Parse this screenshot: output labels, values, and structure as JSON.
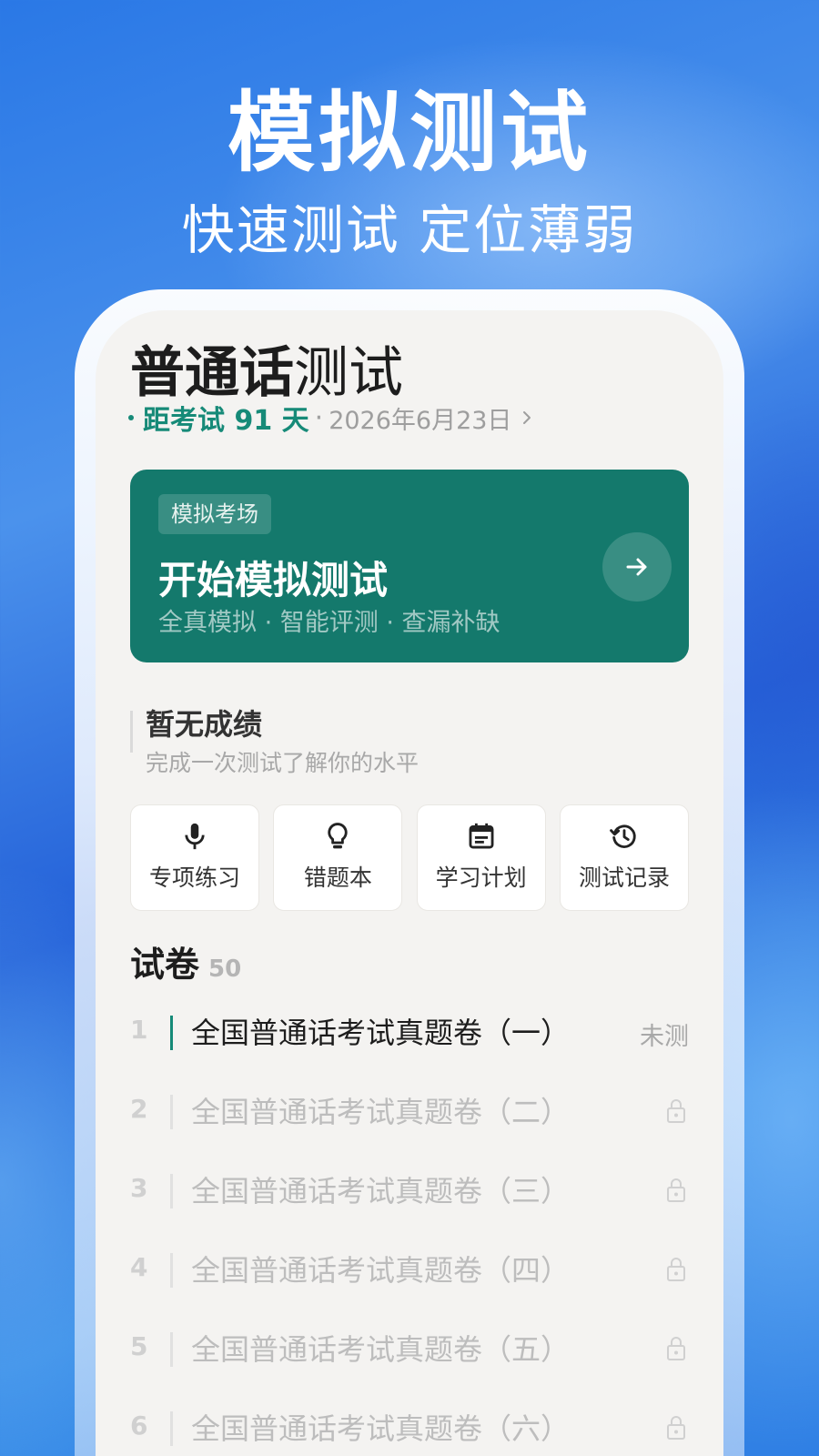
{
  "hero": {
    "title": "模拟测试",
    "subtitle": "快速测试 定位薄弱"
  },
  "app": {
    "title_bold": "普通话",
    "title_rest": "测试",
    "countdown": {
      "label": "距考试 91 天",
      "separator": "·",
      "date": "2026年6月23日"
    }
  },
  "exam_card": {
    "badge": "模拟考场",
    "title": "开始模拟测试",
    "description": "全真模拟 · 智能评测 · 查漏补缺"
  },
  "score": {
    "title": "暂无成绩",
    "subtitle": "完成一次测试了解你的水平"
  },
  "quick_actions": [
    {
      "label": "专项练习",
      "icon": "mic-icon"
    },
    {
      "label": "错题本",
      "icon": "lightbulb-icon"
    },
    {
      "label": "学习计划",
      "icon": "calendar-icon"
    },
    {
      "label": "测试记录",
      "icon": "history-icon"
    }
  ],
  "papers": {
    "title": "试卷",
    "count": "50",
    "items": [
      {
        "num": "1",
        "name": "全国普通话考试真题卷（一）",
        "status": "未测",
        "locked": false
      },
      {
        "num": "2",
        "name": "全国普通话考试真题卷（二）",
        "locked": true
      },
      {
        "num": "3",
        "name": "全国普通话考试真题卷（三）",
        "locked": true
      },
      {
        "num": "4",
        "name": "全国普通话考试真题卷（四）",
        "locked": true
      },
      {
        "num": "5",
        "name": "全国普通话考试真题卷（五）",
        "locked": true
      },
      {
        "num": "6",
        "name": "全国普通话考试真题卷（六）",
        "locked": true
      }
    ]
  },
  "colors": {
    "accent": "#168a78",
    "card": "#14796c",
    "background_blue": "#2a78e6",
    "screen": "#f4f3f1"
  }
}
